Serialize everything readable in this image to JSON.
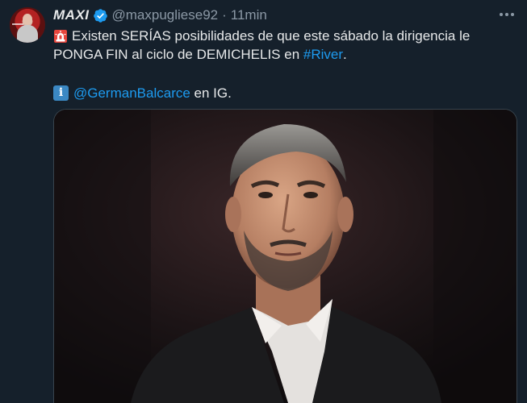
{
  "tweet": {
    "display_name": "MAXI",
    "handle": "@maxpugliese92",
    "separator": "·",
    "timestamp": "11min",
    "line1_text": "Existen SERÍAS posibilidades de que este sábado la dirigencia le",
    "line2_prefix": "PONGA FIN al ciclo de DEMICHELIS en ",
    "line2_hashtag": "#River",
    "line2_suffix": ".",
    "info_glyph": "i",
    "mention": "@GermanBalcarce",
    "mention_suffix": " en IG."
  },
  "colors": {
    "background": "#15202b",
    "text": "#e7e9ea",
    "secondary": "#8b98a5",
    "link": "#1d9bf0",
    "verified": "#1d9bf0"
  },
  "icons": {
    "verified": "verified-badge-icon",
    "siren": "rotating-light-icon",
    "info": "information-icon",
    "more": "more-options-icon"
  }
}
